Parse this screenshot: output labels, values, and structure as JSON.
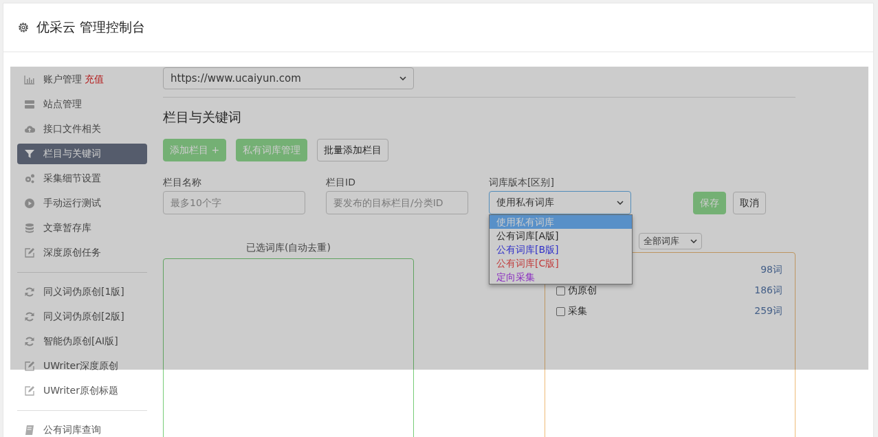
{
  "header": {
    "title": "优采云 管理控制台"
  },
  "sidebar": {
    "groups": [
      [
        {
          "label": "账户管理",
          "badge": "充值",
          "selected": false
        },
        {
          "label": "站点管理",
          "selected": false
        },
        {
          "label": "接口文件相关",
          "selected": false
        },
        {
          "label": "栏目与关键词",
          "selected": true
        },
        {
          "label": "采集细节设置",
          "selected": false
        },
        {
          "label": "手动运行测试",
          "selected": false
        },
        {
          "label": "文章暂存库",
          "selected": false
        },
        {
          "label": "深度原创任务",
          "selected": false
        }
      ],
      [
        {
          "label": "同义词伪原创[1版]",
          "selected": false
        },
        {
          "label": "同义词伪原创[2版]",
          "selected": false
        },
        {
          "label": "智能伪原创[AI版]",
          "selected": false
        },
        {
          "label": "UWriter深度原创",
          "selected": false
        },
        {
          "label": "UWriter原创标题",
          "selected": false
        }
      ],
      [
        {
          "label": "公有词库查询",
          "selected": false
        }
      ]
    ]
  },
  "site_select": {
    "value": "https://www.ucaiyun.com"
  },
  "heading": "栏目与关键词",
  "toolbar": [
    {
      "label": "添加栏目 +",
      "kind": "primary"
    },
    {
      "label": "私有词库管理",
      "kind": "primary"
    },
    {
      "label": "批量添加栏目",
      "kind": "default"
    }
  ],
  "form": {
    "name": {
      "label": "栏目名称",
      "placeholder": "最多10个字"
    },
    "id": {
      "label": "栏目ID",
      "placeholder": "要发布的目标栏目/分类ID"
    },
    "version": {
      "label": "词库版本[区别]",
      "value": "使用私有词库",
      "expanded": true,
      "options": [
        {
          "label": "使用私有词库",
          "selected": true
        },
        {
          "label": "公有词库[A版]",
          "selected": false,
          "color": "#292929"
        },
        {
          "label": "公有词库[B版]",
          "selected": false,
          "color": "#3030c8"
        },
        {
          "label": "公有词库[C版]",
          "selected": false,
          "color": "#c03c3c"
        },
        {
          "label": "定向采集",
          "selected": false,
          "color": "#8a2cc0"
        }
      ]
    },
    "buttons": [
      {
        "label": "保存",
        "kind": "primary"
      },
      {
        "label": "取消",
        "kind": "default"
      }
    ]
  },
  "selected_panel": {
    "title": "已选词库(自动去重)"
  },
  "library_panel": {
    "filter": "全部词库",
    "rows": [
      {
        "count": "98词"
      },
      {
        "label": "伪原创",
        "count": "186词",
        "checked": false
      },
      {
        "label": "采集",
        "count": "259词",
        "checked": false
      }
    ]
  }
}
